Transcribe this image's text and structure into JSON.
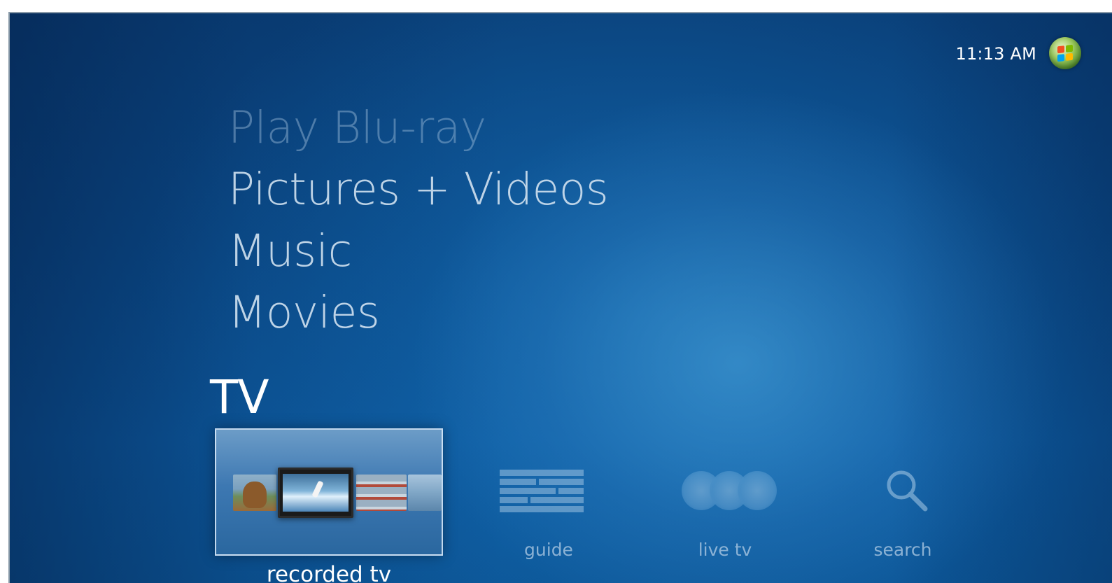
{
  "header": {
    "clock": "11:13 AM",
    "start_icon": "windows-start-orb-icon"
  },
  "menu": {
    "items": [
      {
        "label": "Play Blu-ray"
      },
      {
        "label": "Pictures + Videos"
      },
      {
        "label": "Music"
      },
      {
        "label": "Movies"
      }
    ]
  },
  "tv": {
    "title": "TV",
    "tiles": [
      {
        "label": "recorded tv",
        "icon": "recorded-tv-thumbnails-icon",
        "selected": true
      },
      {
        "label": "guide",
        "icon": "guide-grid-icon"
      },
      {
        "label": "live tv",
        "icon": "live-tv-circles-icon"
      },
      {
        "label": "search",
        "icon": "search-icon"
      }
    ]
  },
  "colors": {
    "background": "#0b4c8c",
    "text_primary": "#ffffff",
    "text_menu": "#cddeee",
    "tile_border": "#dcebfa"
  }
}
